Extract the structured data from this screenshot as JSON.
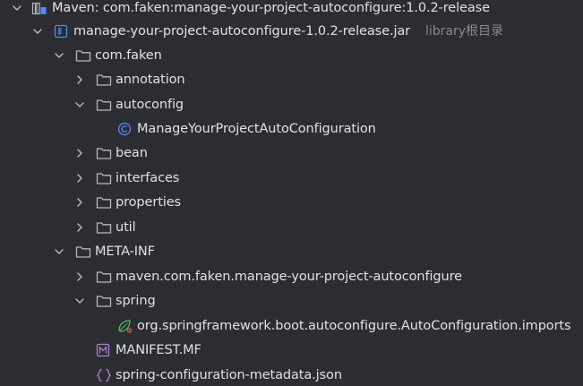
{
  "tree": {
    "root": {
      "label": "Maven: com.faken:manage-your-project-autoconfigure:1.0.2-release",
      "icon": "maven-library-icon",
      "expanded": true
    },
    "jar": {
      "label": "manage-your-project-autoconfigure-1.0.2-release.jar",
      "hint": "library根目录",
      "icon": "jar-archive-icon",
      "expanded": true
    },
    "com_faken": {
      "label": "com.faken",
      "icon": "folder-icon",
      "expanded": true
    },
    "annotation": {
      "label": "annotation",
      "icon": "folder-icon",
      "expanded": false
    },
    "autoconfig": {
      "label": "autoconfig",
      "icon": "folder-icon",
      "expanded": true
    },
    "auto_class": {
      "label": "ManageYourProjectAutoConfiguration",
      "icon": "class-icon",
      "accent": "#548af7"
    },
    "bean": {
      "label": "bean",
      "icon": "folder-icon",
      "expanded": false
    },
    "interfaces": {
      "label": "interfaces",
      "icon": "folder-icon",
      "expanded": false
    },
    "properties": {
      "label": "properties",
      "icon": "folder-icon",
      "expanded": false
    },
    "util": {
      "label": "util",
      "icon": "folder-icon",
      "expanded": false
    },
    "meta_inf": {
      "label": "META-INF",
      "icon": "folder-icon",
      "expanded": true
    },
    "maven_pkg": {
      "label": "maven.com.faken.manage-your-project-autoconfigure",
      "icon": "folder-icon",
      "expanded": false
    },
    "spring": {
      "label": "spring",
      "icon": "folder-icon",
      "expanded": true
    },
    "imports_file": {
      "label": "org.springframework.boot.autoconfigure.AutoConfiguration.imports",
      "icon": "spring-leaf-icon",
      "accent": "#5fb85f"
    },
    "manifest": {
      "label": "MANIFEST.MF",
      "icon": "manifest-icon",
      "accent": "#b07ed7"
    },
    "metadata_json": {
      "label": "spring-configuration-metadata.json",
      "icon": "json-braces-icon",
      "accent": "#b07ed7"
    }
  }
}
